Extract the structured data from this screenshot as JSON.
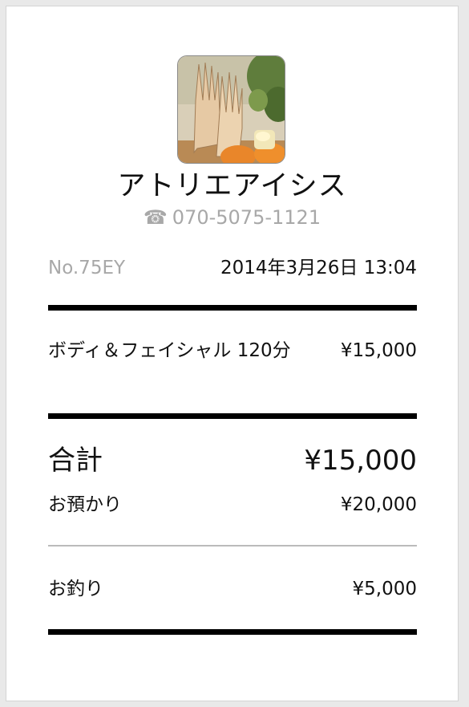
{
  "shop": {
    "name": "アトリエアイシス",
    "phone_icon": "☎",
    "phone": "070-5075-1121"
  },
  "receipt": {
    "number": "No.75EY",
    "datetime": "2014年3月26日 13:04"
  },
  "items": [
    {
      "name": "ボディ＆フェイシャル 120分",
      "price": "¥15,000"
    }
  ],
  "totals": {
    "total_label": "合計",
    "total_value": "¥15,000",
    "received_label": "お預かり",
    "received_value": "¥20,000",
    "change_label": "お釣り",
    "change_value": "¥5,000"
  }
}
